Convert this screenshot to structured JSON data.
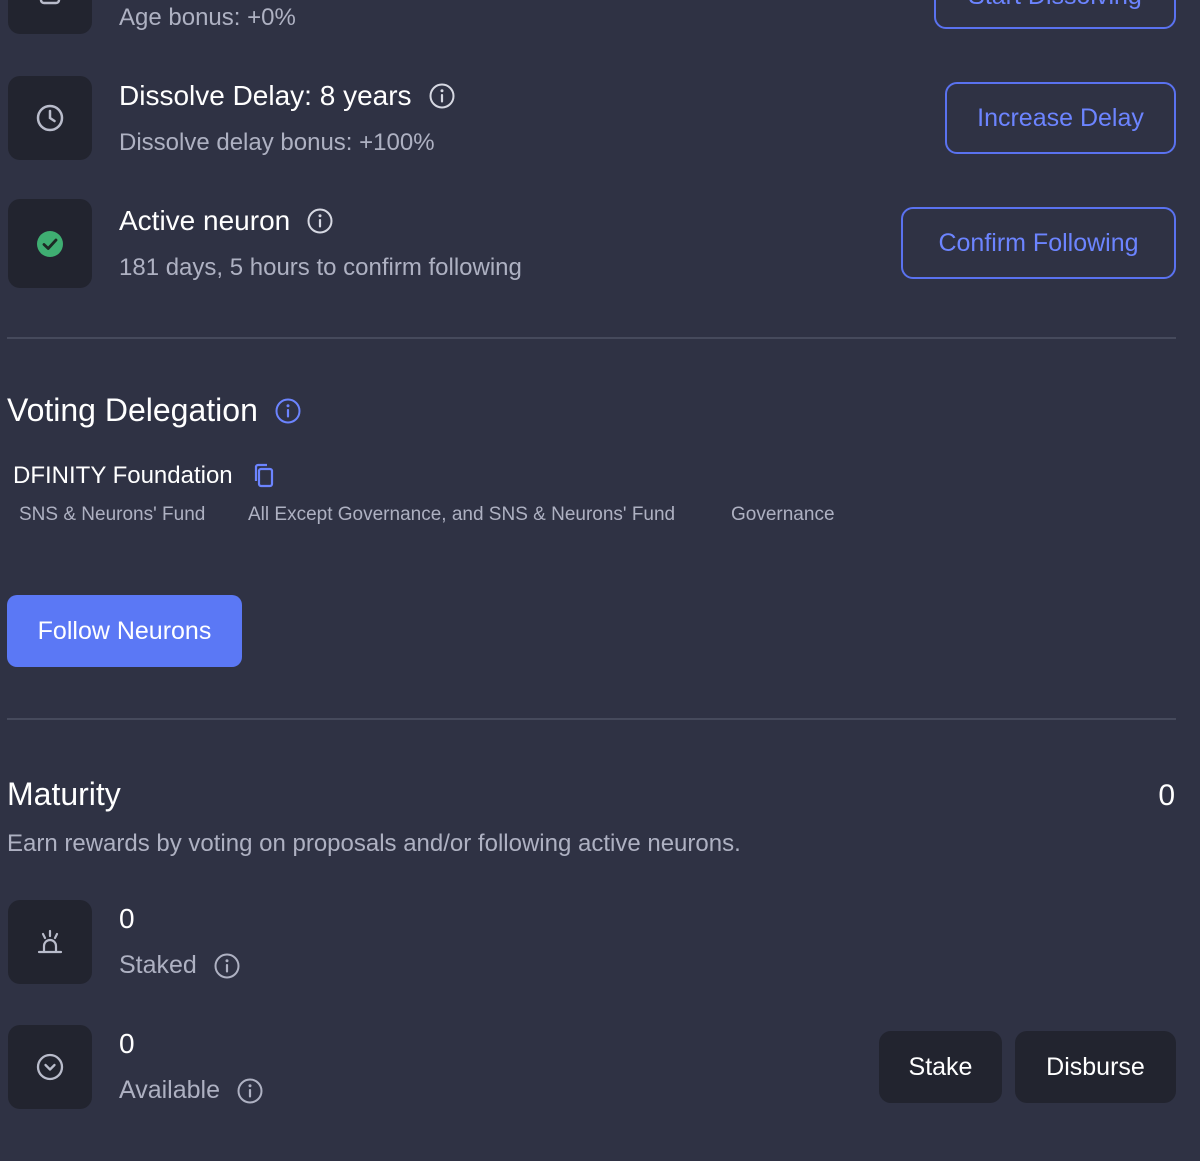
{
  "top_row": {
    "subtitle": "Age bonus: +0%",
    "button_label": "Start Dissolving",
    "icon": "lock-icon"
  },
  "dissolve_row": {
    "title": "Dissolve Delay: 8 years",
    "subtitle": "Dissolve delay bonus: +100%",
    "button_label": "Increase Delay",
    "icon": "clock-icon"
  },
  "active_row": {
    "title": "Active neuron",
    "subtitle": "181 days, 5 hours to confirm following",
    "button_label": "Confirm Following",
    "icon": "check-circle-icon",
    "status_color": "#3fae72"
  },
  "voting_delegation": {
    "title": "Voting Delegation",
    "followee_name": "DFINITY Foundation",
    "topics": [
      "SNS & Neurons' Fund",
      "All Except Governance, and SNS & Neurons' Fund",
      "Governance"
    ],
    "follow_button_label": "Follow Neurons"
  },
  "maturity": {
    "title": "Maturity",
    "total_value": "0",
    "description": "Earn rewards by voting on proposals and/or following active neurons.",
    "staked": {
      "value": "0",
      "label": "Staked",
      "icon": "staking-icon"
    },
    "available": {
      "value": "0",
      "label": "Available",
      "icon": "chevron-down-circle-icon",
      "stake_button_label": "Stake",
      "disburse_button_label": "Disburse"
    }
  },
  "colors": {
    "background": "#2f3244",
    "tile": "#22242f",
    "accent": "#5b78f5",
    "accent_text": "#6c84ff",
    "muted_text": "#aeb1c2"
  }
}
